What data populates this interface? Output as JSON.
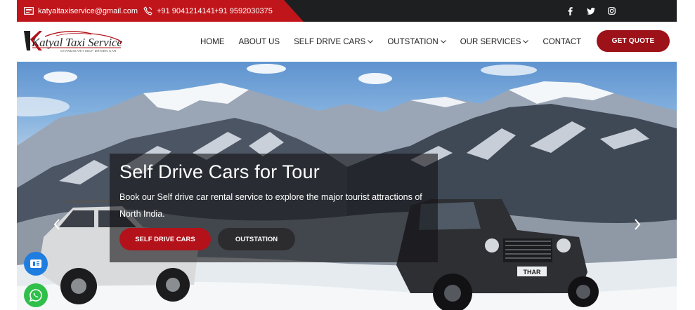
{
  "topbar": {
    "email": "katyaltaxiservice@gmail.com",
    "phone1": "+91 9041214141",
    "phone2": "+91 9592030375",
    "email_icon": "envelope-icon",
    "phone_icon": "phone-icon",
    "social": [
      "facebook-icon",
      "twitter-icon",
      "instagram-icon"
    ]
  },
  "logo": {
    "name": "Katyal Taxi Service",
    "tagline": "CHANDIGARH SELF DRIVEN CAR"
  },
  "nav": {
    "items": [
      {
        "label": "HOME",
        "dropdown": false
      },
      {
        "label": "ABOUT US",
        "dropdown": false
      },
      {
        "label": "SELF DRIVE CARS",
        "dropdown": true
      },
      {
        "label": "OUTSTATION",
        "dropdown": true
      },
      {
        "label": "OUR SERVICES",
        "dropdown": true
      },
      {
        "label": "CONTACT",
        "dropdown": false
      }
    ],
    "cta": "GET QUOTE"
  },
  "hero": {
    "title": "Self  Drive Cars for Tour",
    "text": "Book our Self drive car rental service to explore the major tourist attractions of North  India.",
    "button1": "SELF DRIVE CARS",
    "button2": "OUTSTATION",
    "plate": "THAR"
  },
  "colors": {
    "accent": "#c0161b",
    "cta": "#9c1218",
    "topbar_bg": "#1e1f21",
    "call_button": "#1f7de0",
    "whatsapp_button": "#2fbf4a"
  }
}
